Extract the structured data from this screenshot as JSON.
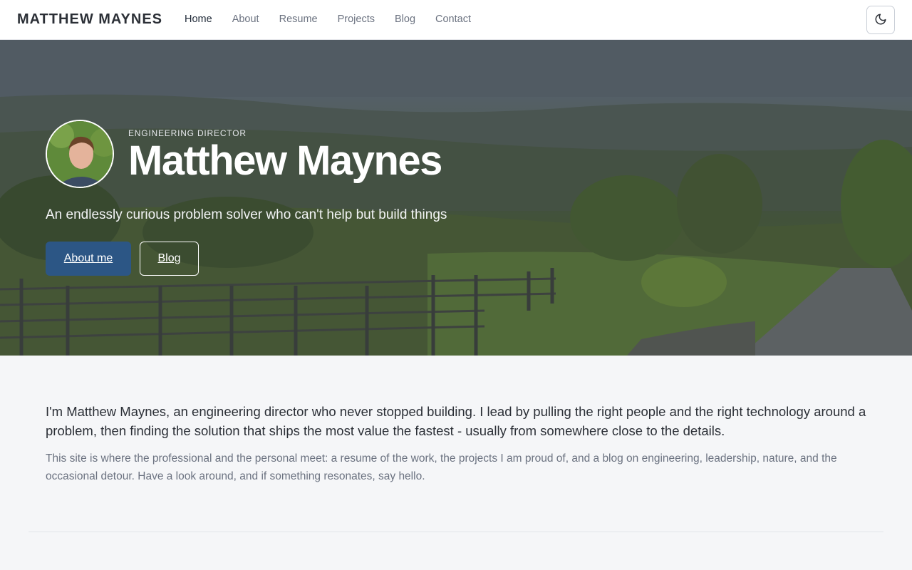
{
  "header": {
    "brand": "MATTHEW MAYNES",
    "nav": [
      {
        "label": "Home",
        "active": true
      },
      {
        "label": "About",
        "active": false
      },
      {
        "label": "Resume",
        "active": false
      },
      {
        "label": "Projects",
        "active": false
      },
      {
        "label": "Blog",
        "active": false
      },
      {
        "label": "Contact",
        "active": false
      }
    ],
    "theme_toggle_icon": "moon-icon"
  },
  "hero": {
    "eyebrow": "ENGINEERING DIRECTOR",
    "title": "Matthew Maynes",
    "tagline": "An endlessly curious problem solver who can't help but build things",
    "primary_button": "About me",
    "secondary_button": "Blog"
  },
  "intro": {
    "lead": "I'm Matthew Maynes, an engineering director who never stopped building. I lead by pulling the right people and the right technology around a problem, then finding the solution that ships the most value the fastest - usually from somewhere close to the details.",
    "body": "This site is where the professional and the personal meet: a resume of the work, the projects I am proud of, and a blog on engineering, leadership, nature, and the occasional detour. Have a look around, and if something resonates, say hello."
  },
  "colors": {
    "accent": "#2c5685",
    "page_bg": "#f5f6f8",
    "muted_text": "#6b7280"
  }
}
